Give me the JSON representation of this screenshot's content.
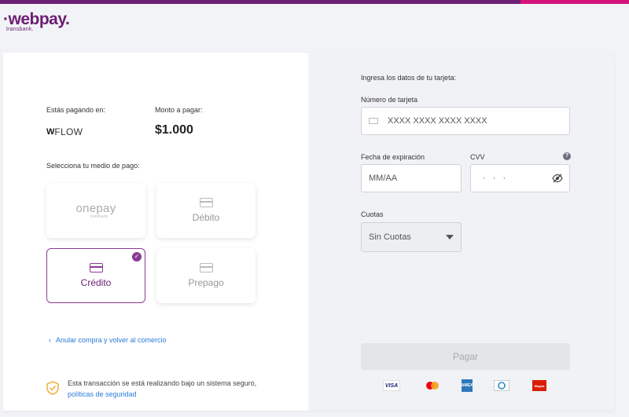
{
  "header": {
    "logo_word": "·webpay.",
    "logo_sub": "transbank."
  },
  "summary": {
    "paying_label": "Estás pagando en:",
    "merchant_mark": "W",
    "merchant_name": "FLOW",
    "amount_label": "Monto a pagar:",
    "amount": "$1.000"
  },
  "payment": {
    "select_label": "Selecciona tu medio de pago:",
    "methods": [
      {
        "label": "onepay",
        "sub": "transbank",
        "selected": false
      },
      {
        "label": "Débito",
        "selected": false
      },
      {
        "label": "Crédito",
        "selected": true
      },
      {
        "label": "Prepago",
        "selected": false
      }
    ],
    "check_mark": "✓"
  },
  "footer_left": {
    "back_chevron": "‹",
    "back_link": "Anular compra y volver al comercio",
    "secure_text": "Esta transacción se está realizando bajo un sistema seguro,",
    "secure_link": "políticas de seguridad"
  },
  "form": {
    "title": "Ingresa los datos de tu tarjeta:",
    "card_number_label": "Número de tarjeta",
    "card_number_placeholder": "XXXX XXXX XXXX XXXX",
    "expiry_label": "Fecha de expiración",
    "expiry_placeholder": "MM/AA",
    "cvv_label": "CVV",
    "cvv_help": "?",
    "cvv_placeholder": "· · ·",
    "installments_label": "Cuotas",
    "installments_value": "Sin Cuotas",
    "pay_button": "Pagar"
  },
  "brands": [
    {
      "name": "VISA",
      "color": "#1a1f71"
    },
    {
      "name": "mastercard",
      "color": "#eb001b"
    },
    {
      "name": "AMEX",
      "color": "#2e77bb"
    },
    {
      "name": "Diners",
      "color": "#0079be"
    },
    {
      "name": "Magna",
      "color": "#d81e05"
    }
  ],
  "colors": {
    "brand": "#6c1d74",
    "accent": "#d4137a",
    "link": "#2a7bd6"
  }
}
